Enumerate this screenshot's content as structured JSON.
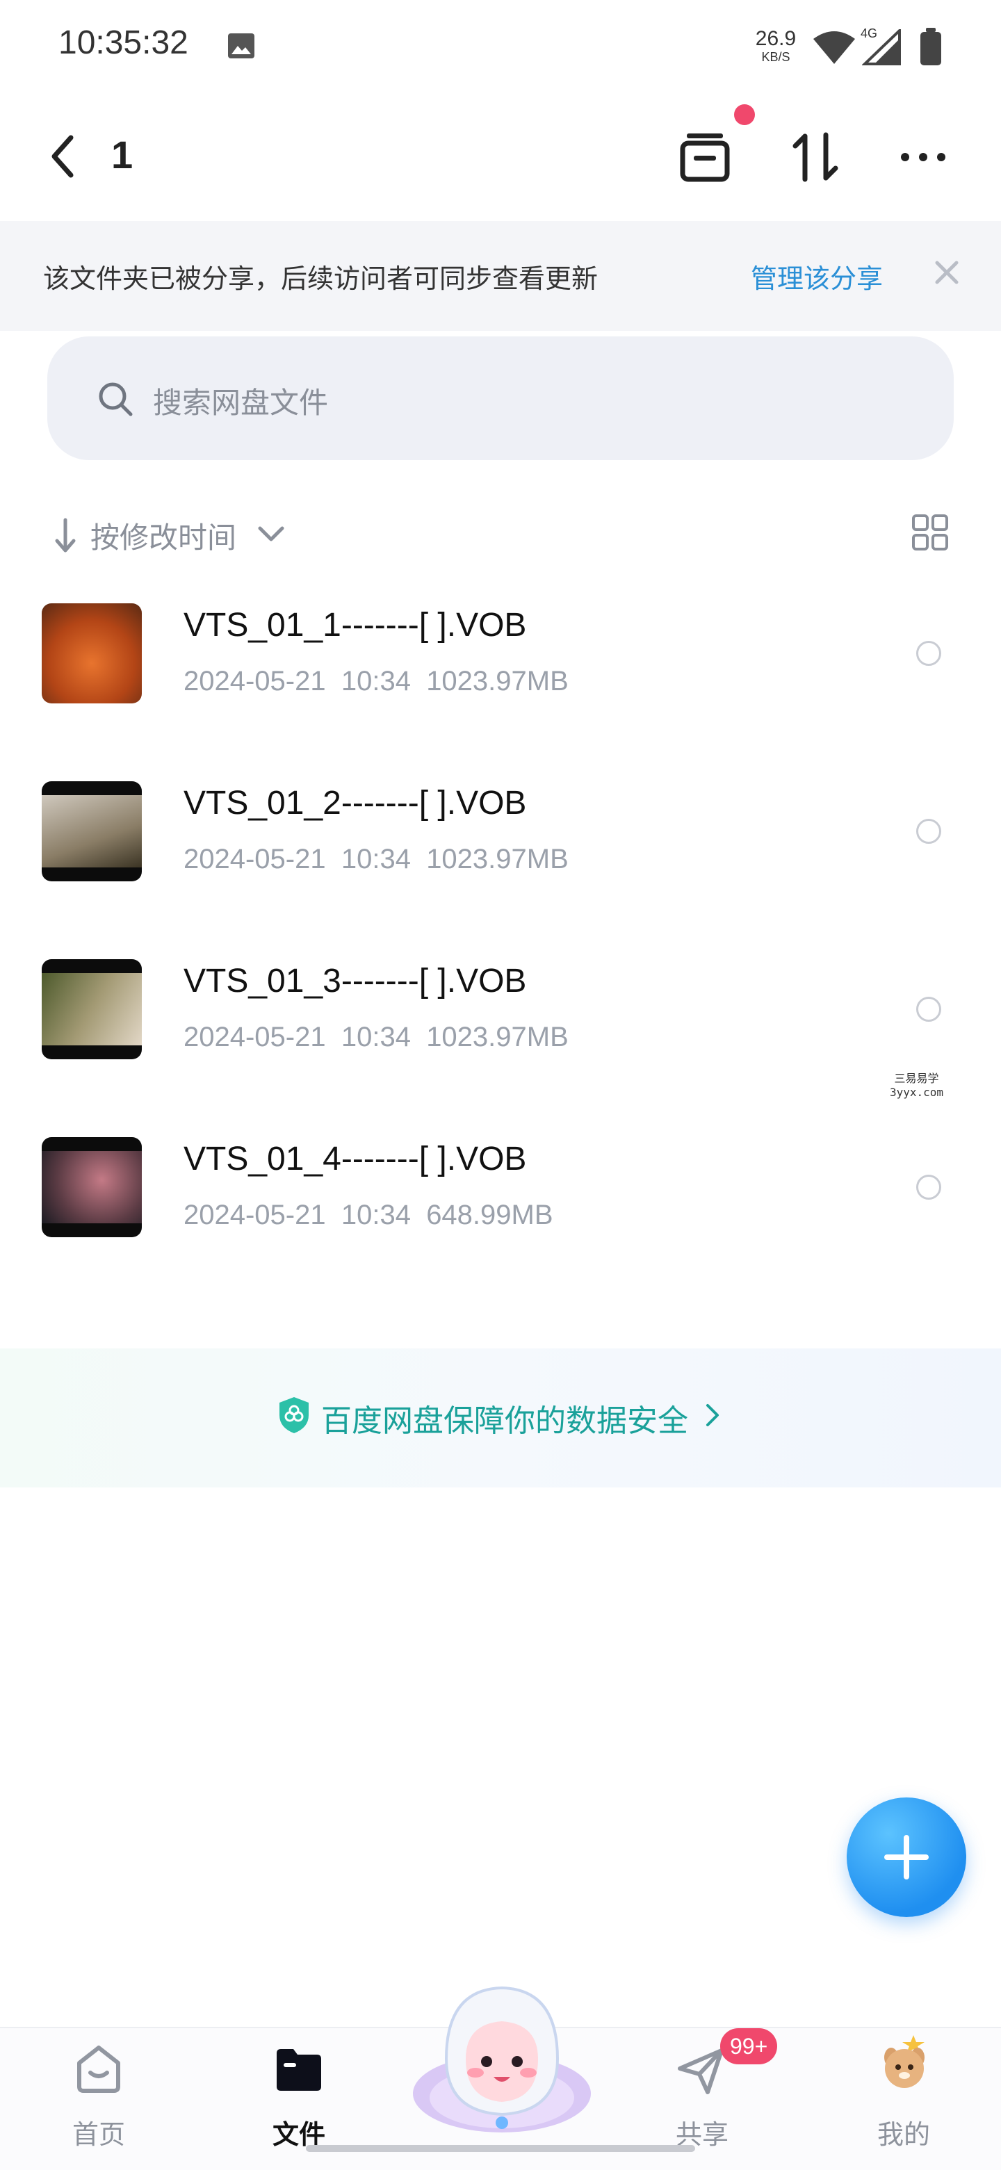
{
  "status": {
    "time": "10:35:32",
    "speed_value": "26.9",
    "speed_unit": "KB/S",
    "network": "4G"
  },
  "header": {
    "title": "1"
  },
  "banner": {
    "text": "该文件夹已被分享，后续访问者可同步查看更新",
    "link": "管理该分享"
  },
  "search": {
    "placeholder": "搜索网盘文件"
  },
  "sort": {
    "label": "按修改时间"
  },
  "files": [
    {
      "name": "VTS_01_1-------[ ].VOB",
      "date": "2024-05-21",
      "time": "10:34",
      "size": "1023.97MB"
    },
    {
      "name": "VTS_01_2-------[ ].VOB",
      "date": "2024-05-21",
      "time": "10:34",
      "size": "1023.97MB"
    },
    {
      "name": "VTS_01_3-------[ ].VOB",
      "date": "2024-05-21",
      "time": "10:34",
      "size": "1023.97MB"
    },
    {
      "name": "VTS_01_4-------[ ].VOB",
      "date": "2024-05-21",
      "time": "10:34",
      "size": "648.99MB"
    }
  ],
  "watermark": {
    "line1": "三易易学",
    "line2": "3yyx.com"
  },
  "security": {
    "text": "百度网盘保障你的数据安全"
  },
  "nav": {
    "home": "首页",
    "files": "文件",
    "share": "共享",
    "share_badge": "99+",
    "me": "我的"
  },
  "colors": {
    "accent": "#2a8fd6",
    "security": "#1aa19a",
    "badge": "#f0486c",
    "fab": "#1f8ff0"
  }
}
